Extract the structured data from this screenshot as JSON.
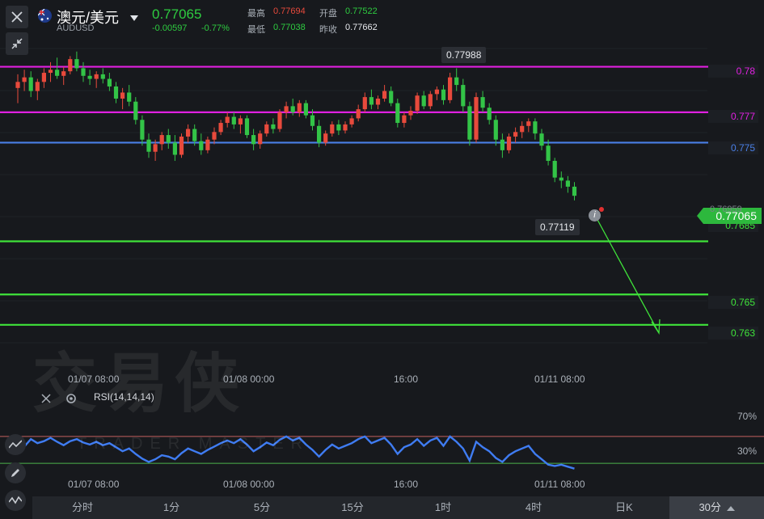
{
  "header": {
    "symbol_name": "澳元/美元",
    "symbol_code": "AUDUSD",
    "last_price": "0.77065",
    "change": "-0.00597",
    "change_pct": "-0.77%",
    "high_label": "最高",
    "high_value": "0.77694",
    "open_label": "开盘",
    "open_value": "0.77522",
    "low_label": "最低",
    "low_value": "0.77038",
    "prev_close_label": "昨收",
    "prev_close_value": "0.77662"
  },
  "levels": [
    {
      "label": "0.78",
      "price": 0.78,
      "color": "#e020e0"
    },
    {
      "label": "0.777",
      "price": 0.777,
      "color": "#e020e0"
    },
    {
      "label": "0.775",
      "price": 0.775,
      "color": "#4a7fe6"
    },
    {
      "label": "0.7685",
      "price": 0.7685,
      "color": "#3fe33a"
    },
    {
      "label": "0.765",
      "price": 0.765,
      "color": "#3fe33a"
    },
    {
      "label": "0.763",
      "price": 0.763,
      "color": "#3fe33a"
    }
  ],
  "current_tag": "0.77065",
  "faint_axis_labels": [
    "0.76959"
  ],
  "callouts": {
    "high": "0.77988",
    "low": "0.77119"
  },
  "x_axis": [
    "01/07 08:00",
    "01/08 00:00",
    "16:00",
    "01/11 08:00"
  ],
  "indicator": {
    "name": "RSI(14,14,14)",
    "upper": "70%",
    "lower": "30%"
  },
  "watermark": {
    "main": "交易侠",
    "sub": "TRADER MASTER"
  },
  "timeframes": [
    "分时",
    "1分",
    "5分",
    "15分",
    "1时",
    "4时",
    "日K",
    "30分"
  ],
  "active_timeframe": "30分",
  "colors": {
    "up": "#e84a3c",
    "down": "#33c447",
    "rsi": "#3f7cf2",
    "bg": "#17191d"
  },
  "icons": [
    "close-icon",
    "flag-icon",
    "dropdown-icon",
    "collapse-icon",
    "settings-icon",
    "pencil-icon",
    "draw-tool-icon",
    "info-icon"
  ],
  "chart_data": {
    "type": "candlestick",
    "y_range": [
      0.7615,
      0.7812
    ],
    "candles": [
      [
        0.7786,
        0.7795,
        0.7776,
        0.779
      ],
      [
        0.779,
        0.7798,
        0.7784,
        0.7793
      ],
      [
        0.7793,
        0.7797,
        0.778,
        0.7784
      ],
      [
        0.7784,
        0.7792,
        0.7778,
        0.779
      ],
      [
        0.779,
        0.7799,
        0.7786,
        0.7796
      ],
      [
        0.7796,
        0.7803,
        0.779,
        0.7798
      ],
      [
        0.7798,
        0.7806,
        0.7792,
        0.7794
      ],
      [
        0.7794,
        0.78,
        0.7788,
        0.7797
      ],
      [
        0.7797,
        0.7807,
        0.7795,
        0.7805
      ],
      [
        0.7805,
        0.781,
        0.7797,
        0.7799
      ],
      [
        0.7799,
        0.7803,
        0.779,
        0.7794
      ],
      [
        0.7794,
        0.7798,
        0.7788,
        0.7792
      ],
      [
        0.7792,
        0.7797,
        0.7786,
        0.7795
      ],
      [
        0.7795,
        0.7799,
        0.7789,
        0.7792
      ],
      [
        0.7792,
        0.7796,
        0.7784,
        0.7787
      ],
      [
        0.7787,
        0.779,
        0.7776,
        0.7779
      ],
      [
        0.7779,
        0.7786,
        0.7772,
        0.7783
      ],
      [
        0.7783,
        0.7788,
        0.7774,
        0.7777
      ],
      [
        0.7777,
        0.778,
        0.7762,
        0.7765
      ],
      [
        0.7765,
        0.7768,
        0.7748,
        0.7752
      ],
      [
        0.7752,
        0.7756,
        0.774,
        0.7744
      ],
      [
        0.7744,
        0.7752,
        0.7738,
        0.7749
      ],
      [
        0.7749,
        0.7757,
        0.7745,
        0.7755
      ],
      [
        0.7755,
        0.7759,
        0.7746,
        0.775
      ],
      [
        0.775,
        0.7755,
        0.7738,
        0.7742
      ],
      [
        0.7742,
        0.7756,
        0.774,
        0.7754
      ],
      [
        0.7754,
        0.7762,
        0.775,
        0.7759
      ],
      [
        0.7759,
        0.7762,
        0.7748,
        0.7751
      ],
      [
        0.7751,
        0.7756,
        0.7742,
        0.7745
      ],
      [
        0.7745,
        0.7754,
        0.7743,
        0.7752
      ],
      [
        0.7752,
        0.776,
        0.7749,
        0.7757
      ],
      [
        0.7757,
        0.7765,
        0.7755,
        0.7763
      ],
      [
        0.7763,
        0.777,
        0.776,
        0.7767
      ],
      [
        0.7767,
        0.777,
        0.7759,
        0.7762
      ],
      [
        0.7762,
        0.7768,
        0.7756,
        0.7766
      ],
      [
        0.7766,
        0.7768,
        0.7753,
        0.7755
      ],
      [
        0.7755,
        0.7759,
        0.7745,
        0.7749
      ],
      [
        0.7749,
        0.7758,
        0.7746,
        0.7756
      ],
      [
        0.7756,
        0.7764,
        0.7754,
        0.7762
      ],
      [
        0.7762,
        0.7766,
        0.7756,
        0.7759
      ],
      [
        0.7759,
        0.7772,
        0.7757,
        0.777
      ],
      [
        0.777,
        0.7777,
        0.7766,
        0.7774
      ],
      [
        0.7774,
        0.7779,
        0.7768,
        0.777
      ],
      [
        0.777,
        0.7778,
        0.7767,
        0.7776
      ],
      [
        0.7776,
        0.7778,
        0.7766,
        0.7768
      ],
      [
        0.7768,
        0.7772,
        0.7758,
        0.7761
      ],
      [
        0.7761,
        0.7765,
        0.7747,
        0.775
      ],
      [
        0.775,
        0.7758,
        0.7748,
        0.7756
      ],
      [
        0.7756,
        0.7764,
        0.7754,
        0.7762
      ],
      [
        0.7762,
        0.7765,
        0.7755,
        0.7758
      ],
      [
        0.7758,
        0.7764,
        0.7756,
        0.7762
      ],
      [
        0.7762,
        0.7768,
        0.776,
        0.7766
      ],
      [
        0.7766,
        0.7775,
        0.7764,
        0.7772
      ],
      [
        0.7772,
        0.7783,
        0.777,
        0.778
      ],
      [
        0.778,
        0.7785,
        0.7772,
        0.7775
      ],
      [
        0.7775,
        0.7781,
        0.7772,
        0.7779
      ],
      [
        0.7779,
        0.7788,
        0.7777,
        0.7784
      ],
      [
        0.7784,
        0.7787,
        0.7774,
        0.7776
      ],
      [
        0.7776,
        0.7779,
        0.776,
        0.7763
      ],
      [
        0.7763,
        0.777,
        0.776,
        0.7768
      ],
      [
        0.7768,
        0.7774,
        0.7765,
        0.7771
      ],
      [
        0.7771,
        0.7783,
        0.7769,
        0.7781
      ],
      [
        0.7781,
        0.7784,
        0.7772,
        0.7774
      ],
      [
        0.7774,
        0.7784,
        0.7772,
        0.7782
      ],
      [
        0.7782,
        0.7787,
        0.7778,
        0.7785
      ],
      [
        0.7785,
        0.7788,
        0.7775,
        0.7778
      ],
      [
        0.7778,
        0.7796,
        0.7776,
        0.7793
      ],
      [
        0.7793,
        0.7799,
        0.7784,
        0.7788
      ],
      [
        0.7788,
        0.7792,
        0.777,
        0.7774
      ],
      [
        0.7774,
        0.7777,
        0.7748,
        0.7752
      ],
      [
        0.7752,
        0.7783,
        0.775,
        0.778
      ],
      [
        0.778,
        0.7784,
        0.777,
        0.7773
      ],
      [
        0.7773,
        0.7776,
        0.7762,
        0.7765
      ],
      [
        0.7765,
        0.7768,
        0.7748,
        0.7752
      ],
      [
        0.7752,
        0.7756,
        0.774,
        0.7745
      ],
      [
        0.7745,
        0.7756,
        0.7743,
        0.7754
      ],
      [
        0.7754,
        0.776,
        0.775,
        0.7757
      ],
      [
        0.7757,
        0.7764,
        0.7753,
        0.7761
      ],
      [
        0.7761,
        0.7766,
        0.7757,
        0.7764
      ],
      [
        0.7764,
        0.7766,
        0.7752,
        0.7756
      ],
      [
        0.7756,
        0.7759,
        0.7745,
        0.7748
      ],
      [
        0.7748,
        0.7752,
        0.7735,
        0.7738
      ],
      [
        0.7738,
        0.774,
        0.7724,
        0.7727
      ],
      [
        0.7727,
        0.7731,
        0.772,
        0.7725
      ],
      [
        0.7725,
        0.7728,
        0.7717,
        0.7721
      ],
      [
        0.7721,
        0.7724,
        0.7712,
        0.7715
      ]
    ],
    "rsi_range": [
      0,
      100
    ],
    "rsi": [
      48,
      55,
      66,
      60,
      63,
      68,
      62,
      57,
      63,
      66,
      61,
      58,
      62,
      57,
      60,
      54,
      48,
      52,
      44,
      37,
      32,
      36,
      42,
      40,
      36,
      45,
      52,
      48,
      44,
      50,
      55,
      60,
      64,
      60,
      66,
      58,
      48,
      54,
      61,
      57,
      65,
      70,
      64,
      68,
      58,
      50,
      40,
      50,
      58,
      52,
      56,
      60,
      66,
      70,
      60,
      64,
      68,
      58,
      44,
      54,
      58,
      66,
      56,
      64,
      68,
      56,
      70,
      62,
      52,
      34,
      62,
      54,
      48,
      38,
      32,
      42,
      48,
      52,
      56,
      44,
      36,
      28,
      26,
      28,
      25,
      22
    ]
  }
}
